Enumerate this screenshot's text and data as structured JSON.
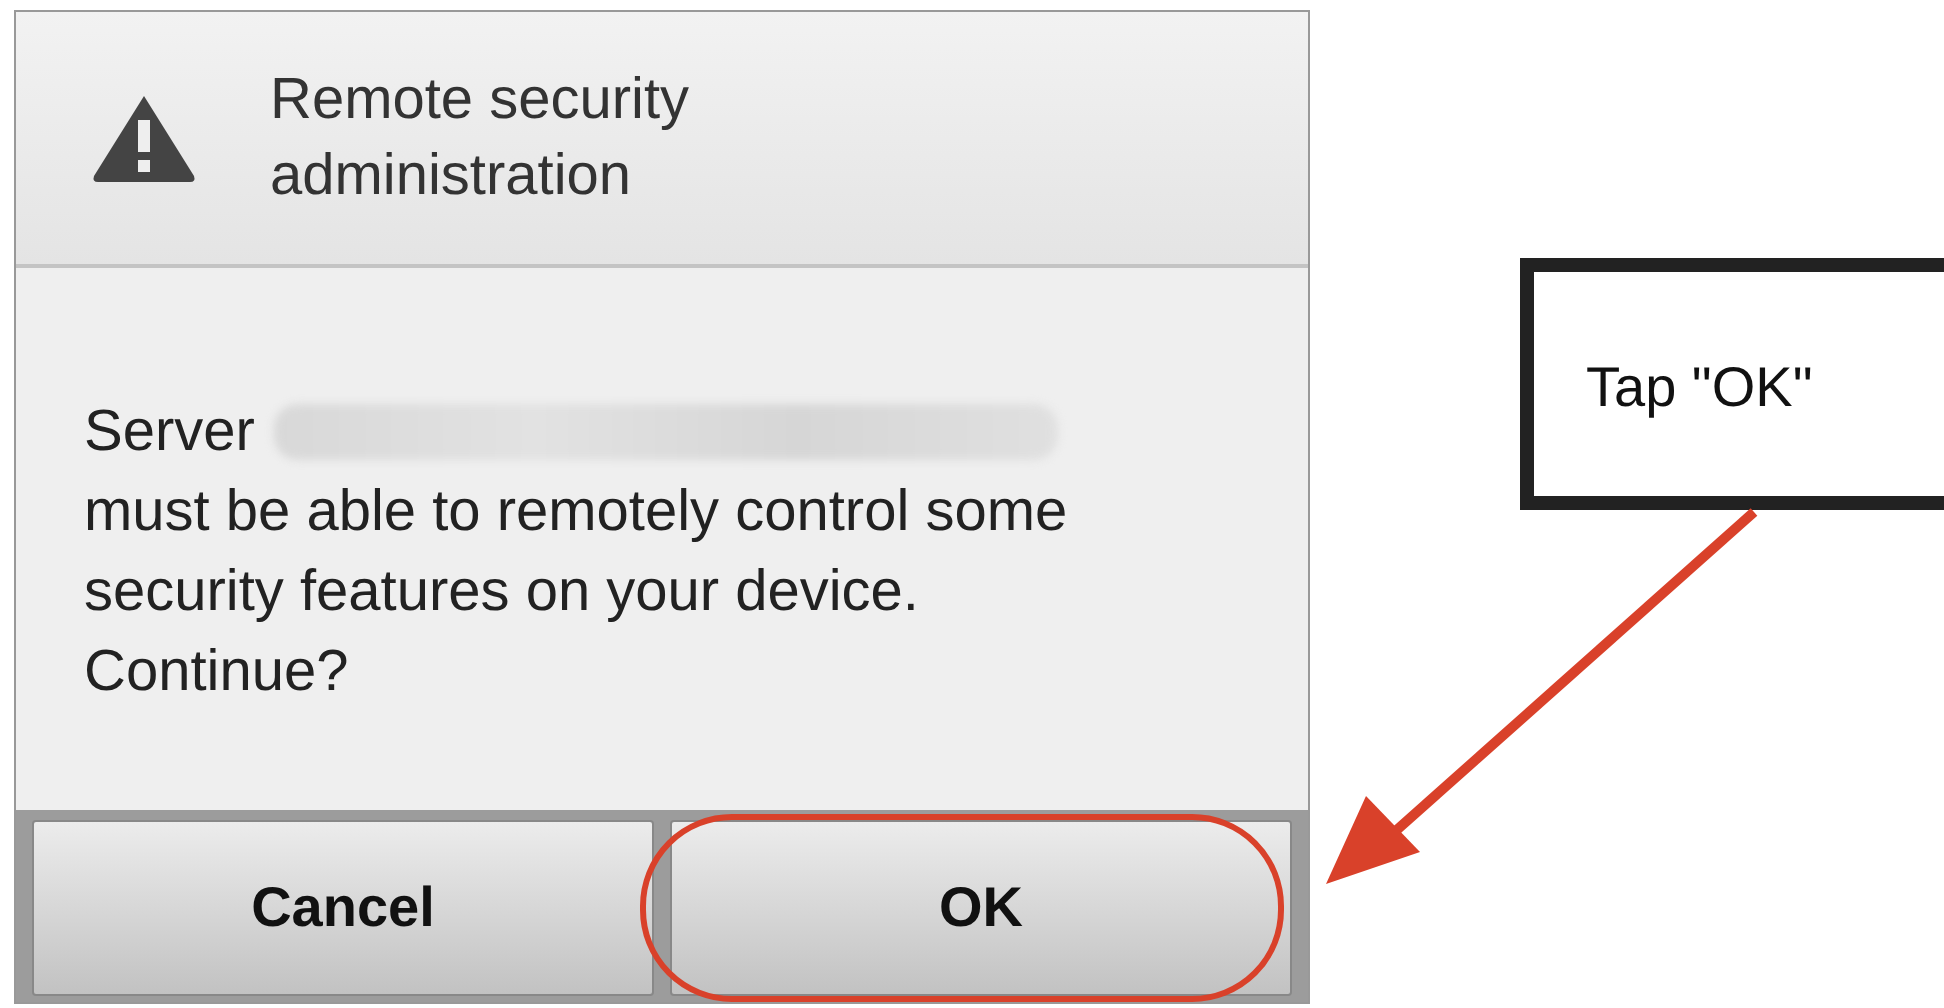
{
  "dialog": {
    "title": "Remote security administration",
    "message_lead": "Server",
    "message": "must be able to remotely control some security features on your device. Continue?",
    "buttons": [
      {
        "label": "Cancel",
        "highlighted": false
      },
      {
        "label": "OK",
        "highlighted": true
      }
    ]
  },
  "callout": {
    "text": "Tap \"OK\""
  }
}
